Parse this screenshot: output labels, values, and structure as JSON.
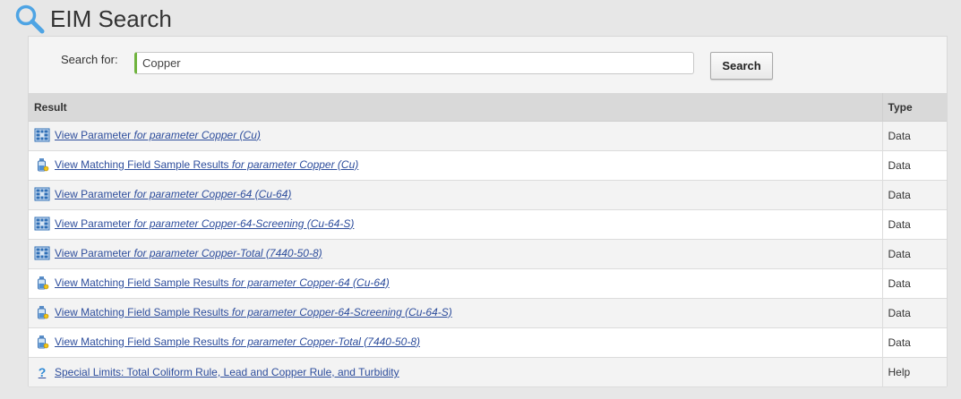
{
  "header": {
    "title": "EIM Search",
    "icon": "magnifier-icon",
    "icon_color": "#4ea4e4"
  },
  "search": {
    "label": "Search for:",
    "value": "Copper",
    "button_label": "Search",
    "accent_color": "#6fb33d"
  },
  "table": {
    "columns": [
      "Result",
      "Type"
    ],
    "rows": [
      {
        "icon": "parameter-grid-icon",
        "action": "View Parameter",
        "qualifier": "for parameter Copper (Cu)",
        "type": "Data"
      },
      {
        "icon": "sample-bottle-icon",
        "action": "View Matching Field Sample Results",
        "qualifier": "for parameter Copper (Cu)",
        "type": "Data"
      },
      {
        "icon": "parameter-grid-icon",
        "action": "View Parameter",
        "qualifier": "for parameter Copper-64 (Cu-64)",
        "type": "Data"
      },
      {
        "icon": "parameter-grid-icon",
        "action": "View Parameter",
        "qualifier": "for parameter Copper-64-Screening (Cu-64-S)",
        "type": "Data"
      },
      {
        "icon": "parameter-grid-icon",
        "action": "View Parameter",
        "qualifier": "for parameter Copper-Total (7440-50-8)",
        "type": "Data"
      },
      {
        "icon": "sample-bottle-icon",
        "action": "View Matching Field Sample Results",
        "qualifier": "for parameter Copper-64 (Cu-64)",
        "type": "Data"
      },
      {
        "icon": "sample-bottle-icon",
        "action": "View Matching Field Sample Results",
        "qualifier": "for parameter Copper-64-Screening (Cu-64-S)",
        "type": "Data"
      },
      {
        "icon": "sample-bottle-icon",
        "action": "View Matching Field Sample Results",
        "qualifier": "for parameter Copper-Total (7440-50-8)",
        "type": "Data"
      },
      {
        "icon": "help-question-icon",
        "action": "Special Limits: Total Coliform Rule, Lead and Copper Rule, and Turbidity",
        "qualifier": "",
        "type": "Help"
      }
    ]
  },
  "colors": {
    "link": "#2d4d9c",
    "header_bg": "#d9d9d9",
    "row_alt_bg": "#f3f3f3"
  }
}
